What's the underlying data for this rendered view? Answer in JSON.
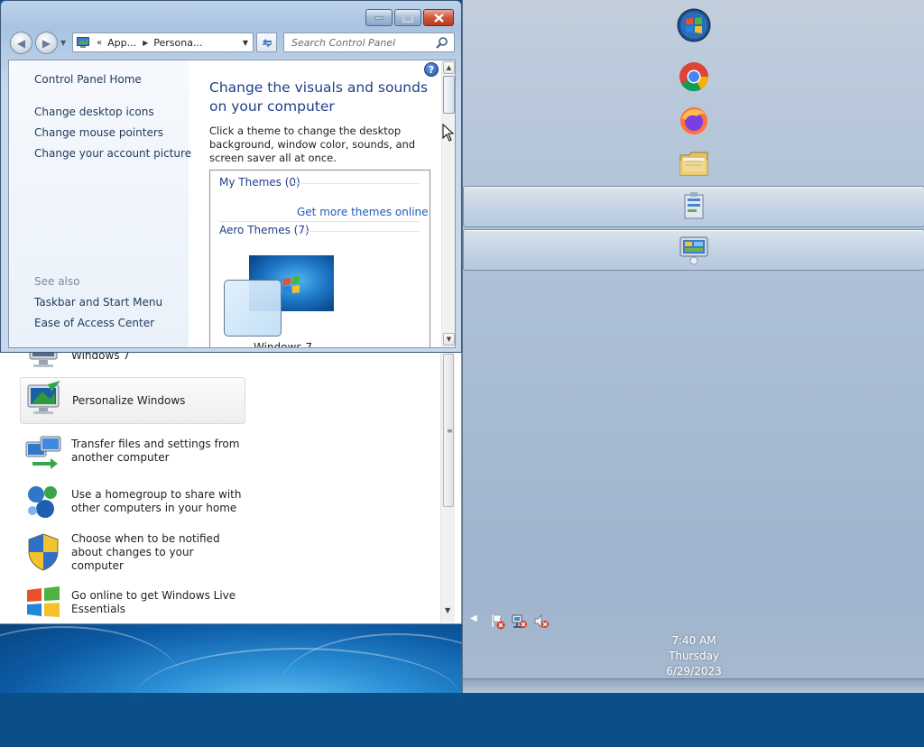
{
  "window": {
    "address": {
      "overflow": "«",
      "crumbs": [
        "App...",
        "Persona..."
      ]
    },
    "search_placeholder": "Search Control Panel",
    "left_pane": {
      "home_link": "Control Panel Home",
      "links": [
        "Change desktop icons",
        "Change mouse pointers",
        "Change your account picture"
      ],
      "see_also_label": "See also",
      "see_also_links": [
        "Taskbar and Start Menu",
        "Ease of Access Center"
      ]
    },
    "main": {
      "title": "Change the visuals and sounds on your computer",
      "description": "Click a theme to change the desktop background, window color, sounds, and screen saver all at once.",
      "my_themes_label": "My Themes (0)",
      "get_more_link": "Get more themes online",
      "aero_themes_label": "Aero Themes (7)",
      "theme_name": "Windows 7"
    }
  },
  "start_menu": {
    "items": [
      {
        "label": "Windows 7",
        "icon": "monitor-icon",
        "selected": false
      },
      {
        "label": "Personalize Windows",
        "icon": "personalize-icon",
        "selected": true
      },
      {
        "label": "Transfer files and settings from another computer",
        "icon": "transfer-icon",
        "selected": false
      },
      {
        "label": "Use a homegroup to share with other computers in your home",
        "icon": "homegroup-icon",
        "selected": false
      },
      {
        "label": "Choose when to be notified about changes to your computer",
        "icon": "uac-shield-icon",
        "selected": false
      },
      {
        "label": "Go online to get Windows Live Essentials",
        "icon": "windows-live-icon",
        "selected": false
      }
    ]
  },
  "taskbar": {
    "pinned": [
      "start-orb-icon",
      "chrome-icon",
      "firefox-icon",
      "file-explorer-icon",
      "task-manager-icon",
      "control-panel-icon"
    ],
    "active_slots": [
      "task-manager-icon",
      "control-panel-icon"
    ],
    "tray_icons": [
      "show-hidden-icons-arrow",
      "action-center-error-icon",
      "network-error-icon",
      "volume-muted-icon"
    ],
    "clock": {
      "time": "7:40 AM",
      "day": "Thursday",
      "date": "6/29/2023"
    }
  },
  "colors": {
    "link": "#1e395b",
    "heading": "#1e3f8c",
    "taskbar": "#adc0d6",
    "close_button": "#c8472c"
  }
}
